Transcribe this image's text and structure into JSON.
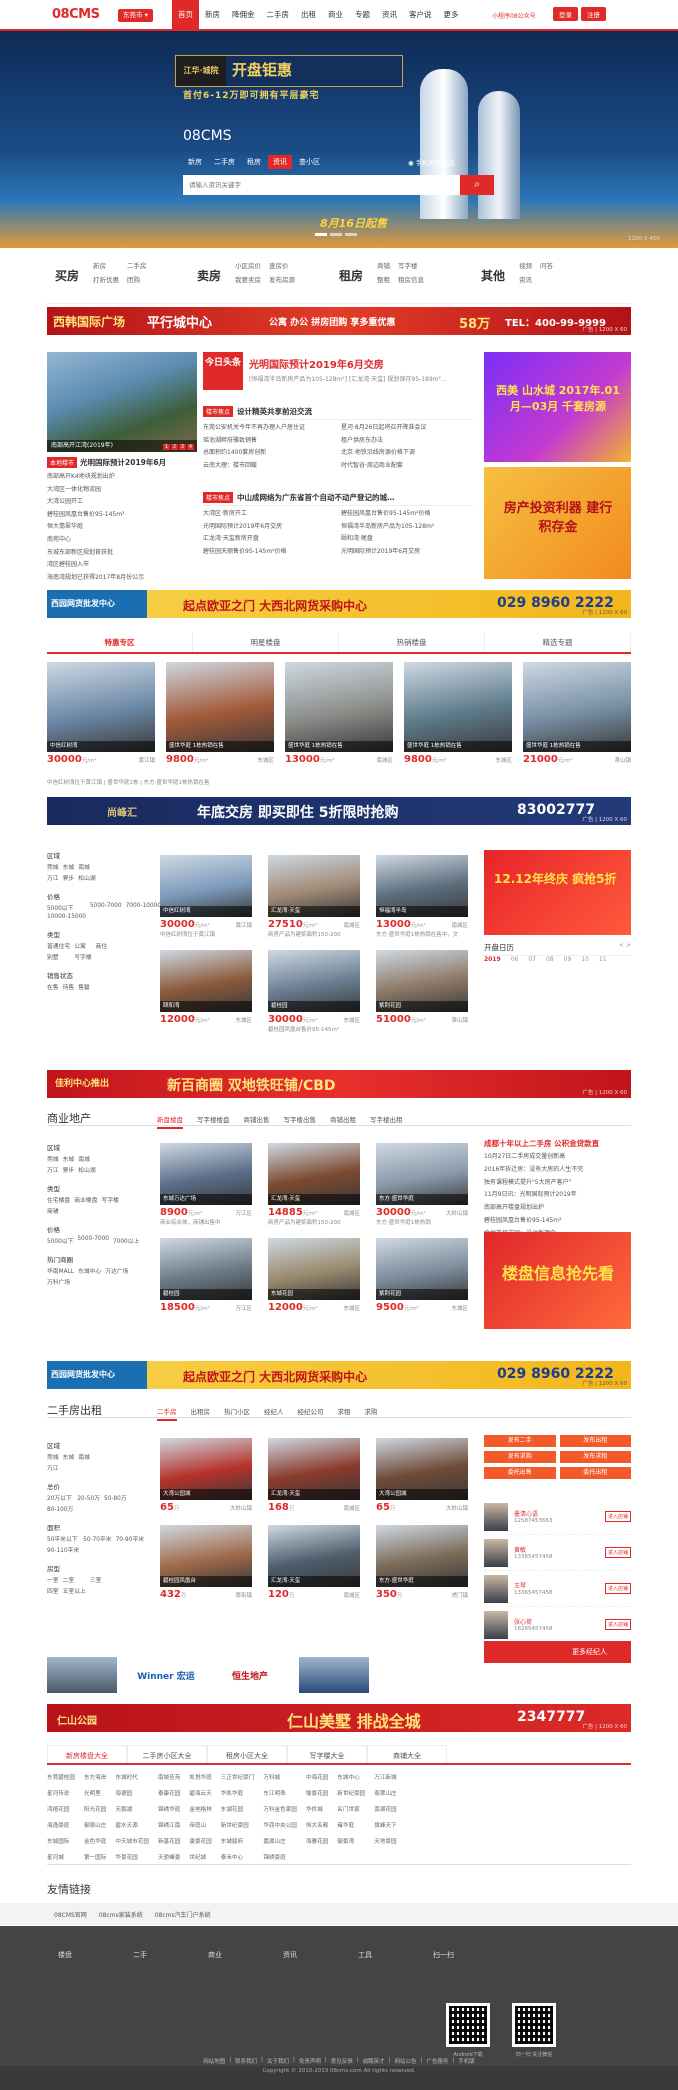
{
  "header": {
    "logo": "08CMS",
    "city": "东莞市",
    "nav": [
      "首页",
      "新房",
      "降佣金",
      "二手房",
      "出租",
      "商业",
      "专题",
      "资讯",
      "客户说",
      "更多"
    ],
    "hotline": "小程序08公众号",
    "login": "登录",
    "register": "注册"
  },
  "hero": {
    "promo_badge": "江华·城院",
    "promo_title": "开盘钜惠",
    "promo_sub": "首付6-12万即可拥有平层豪宅",
    "brand": "08CMS",
    "search_tabs": [
      "新房",
      "二手房",
      "租房",
      "资讯",
      "查小区"
    ],
    "search_active": 3,
    "map_link": "手机地图找房",
    "search_placeholder": "请输入资讯关键字",
    "search_icon": "search-icon",
    "slogan": "8月16日起售",
    "ad_size": "1200 X 450"
  },
  "quick_links": [
    {
      "title": "买房",
      "links": [
        "新房",
        "二手房",
        "打折优惠",
        "团购"
      ]
    },
    {
      "title": "卖房",
      "links": [
        "小区房价",
        "查房价",
        "我要卖房",
        "发布房源"
      ]
    },
    {
      "title": "租房",
      "links": [
        "商铺",
        "写字楼",
        "整租",
        "租房信息"
      ]
    },
    {
      "title": "其他",
      "links": [
        "视频",
        "问答",
        "资讯"
      ]
    }
  ],
  "banner1": {
    "left": "西韩国际广场",
    "mid": "平行城中心",
    "items": "公寓 办公 拼房团购 享多重优惠",
    "amount": "58万",
    "phone": "TEL：400-99-9999",
    "tag": "广告 | 1200 X 60"
  },
  "news": {
    "main_pic_caption": "南部高开江湾(2019年)",
    "main_pic_pages": [
      "1",
      "2",
      "3",
      "4"
    ],
    "left_head_tag": "本地楼市",
    "left_head_title": "光明国际预计2019年6月",
    "left_items": [
      "南部高开K4地块规划出炉",
      "大湾区一体化物流园",
      "大湾公园开工",
      "碧桂园凤凰台售价95-145m²",
      "恒大翡翠华庭",
      "南苑中心",
      "东城东部新区规划首获批",
      "湾区碧桂园入市",
      "海南湾规划已获得2017年8月份公示"
    ],
    "headline_logo": "今日头条",
    "headline_title": "光明国际预计2019年6月交房",
    "headline_sub": "[恒福湾半岛新房产品为105-128m²] [汇龙湾·天玺] 规划保存95-189m²…",
    "sections": [
      {
        "tag": "楼市焦点",
        "title": "设计精英共享前沿交流",
        "items": [
          "东莞公安机关今年不再办理入户居住证",
          "星河·8月26日起将召开降准会议",
          "瑶池湖畔府雅致销售",
          "租户供房东办法",
          "总面积约1400套房创新",
          "北京·地铁沿线房源价格下调",
          "云南大理：楼市回暖",
          "时代智谷·周边商业配套"
        ]
      },
      {
        "tag": "楼市焦点",
        "title": "中山成网络为广东省首个自动不动产登记的城…",
        "items": [
          "大湾区·新房开工",
          "碧桂园凤凰台售价95-145m²价格",
          "光明国际预计2019年6月交房",
          "恒福湾半岛新房产品为105-128m²",
          "汇龙湾·天玺新房开盘",
          "颐和湾·尾盘",
          "碧桂园天丽售价95-145m²价格",
          "光明国际预计2019年6月交房"
        ]
      }
    ],
    "right_ad1": "西美 山水城 2017年.01月—03月 千套房源",
    "right_ad2": "房产投资利器 建行积存金"
  },
  "banner2": {
    "left": "西园网货批发中心",
    "mid": "起点欧亚之门 大西北网货采购中心",
    "phone": "029 8960 2222",
    "tag": "广告 | 1200 X 60"
  },
  "special_tabs": [
    "特惠专区",
    "明星楼盘",
    "热销楼盘",
    "精选专题"
  ],
  "special_props": [
    {
      "cap": "中信红树湾",
      "price": "30000",
      "unit": "元/m²",
      "dist": "黄江镇",
      "c": "#6d89a8"
    },
    {
      "cap": "盛世华庭 1栋热销在售",
      "price": "9800",
      "unit": "元/m²",
      "dist": "东城区",
      "c": "#a35a3a"
    },
    {
      "cap": "盛世华庭 1栋热销在售",
      "price": "13000",
      "unit": "元/m²",
      "dist": "南城区",
      "c": "#8c8e8a"
    },
    {
      "cap": "盛世华庭 1栋热销在售",
      "price": "9800",
      "unit": "元/m²",
      "dist": "东城区",
      "c": "#5f7c8c"
    },
    {
      "cap": "盛世华庭 1栋热销在售",
      "price": "21000",
      "unit": "元/m²",
      "dist": "茶山镇",
      "c": "#7890a6"
    }
  ],
  "special_desc": "中信红树湾位于黄江镇 | 盛世华庭1栋 | 东方·盛世华庭1栋热销在售",
  "banner3": {
    "left": "尚峰汇",
    "mid": "年底交房 即买即住 5折限时抢购",
    "phone": "83002777",
    "tag": "广告 | 1200 X 60"
  },
  "newhouse": {
    "filters": [
      {
        "label": "区域",
        "opts": [
          "莞城",
          "东城",
          "南城",
          "万江",
          "寮步",
          "松山湖"
        ]
      },
      {
        "label": "价格",
        "opts": [
          "5000以下",
          "5000-7000",
          "7000-10000",
          "10000-15000"
        ]
      },
      {
        "label": "类型",
        "opts": [
          "普通住宅",
          "公寓",
          "商住",
          "别墅",
          "写字楼"
        ]
      },
      {
        "label": "销售状态",
        "opts": [
          "在售",
          "待售",
          "售罄"
        ]
      }
    ],
    "props": [
      {
        "cap": "中信红树湾",
        "price": "30000",
        "unit": "元/m²",
        "dist": "黄江镇",
        "desc": "中信红树湾位于黄江镇",
        "c": "#7c9abb"
      },
      {
        "cap": "汇龙湾·天玺",
        "price": "27510",
        "unit": "元/m²",
        "dist": "南城区",
        "desc": "新房产品为建筑面积150-200",
        "c": "#a08a76"
      },
      {
        "cap": "恒福湾半岛",
        "price": "13000",
        "unit": "元/m²",
        "dist": "南城区",
        "desc": "东方·盛世华庭1栋热销在售中，文",
        "c": "#5b6d7c"
      },
      {
        "cap": "颐和湾",
        "price": "12000",
        "unit": "元/m²",
        "dist": "东城区",
        "desc": "",
        "c": "#8a5a3c"
      },
      {
        "cap": "碧桂园",
        "price": "30000",
        "unit": "元/m²",
        "dist": "东城区",
        "desc": "碧桂园凤凰台售价95-145m²",
        "c": "#6b7f93"
      },
      {
        "cap": "紫荆花园",
        "price": "51000",
        "unit": "元/m²",
        "dist": "茶山镇",
        "desc": "",
        "c": "#8d7967"
      }
    ],
    "cal_ad": "12.12年终庆 疯抢5折",
    "cal_title": "开盘日历",
    "cal_nav": "< >",
    "cal_year": "2019",
    "cal_days": [
      "2019",
      "06",
      "07",
      "08",
      "09",
      "10",
      "11"
    ]
  },
  "banner4": {
    "left": "佳利中心推出",
    "mid": "新百商圈 双地铁旺铺/CBD",
    "tag": "广告 | 1200 X 60"
  },
  "commercial": {
    "title": "商业地产",
    "tabs": [
      "新盘楼盘",
      "写字楼楼盘",
      "商铺出售",
      "写字楼出售",
      "商铺出租",
      "写字楼出租"
    ],
    "filters": [
      {
        "label": "区域",
        "opts": [
          "莞城",
          "东城",
          "南城",
          "万江",
          "寮步",
          "松山湖"
        ]
      },
      {
        "label": "类型",
        "opts": [
          "住宅楼盘",
          "商业楼盘",
          "写字楼",
          "商铺"
        ]
      },
      {
        "label": "价格",
        "opts": [
          "5000以下",
          "5000-7000",
          "7000以上"
        ]
      },
      {
        "label": "热门商圈",
        "opts": [
          "华南MALL",
          "东城中心",
          "万达广场",
          "万科广场"
        ]
      }
    ],
    "props": [
      {
        "cap": "东城万达广场",
        "price": "8900",
        "unit": "元/m²",
        "dist": "万江区",
        "desc": "商业综合体，商铺出售中",
        "c": "#5a6e88"
      },
      {
        "cap": "汇龙湾·天玺",
        "price": "14885",
        "unit": "元/m²",
        "dist": "南城区",
        "desc": "新房产品为建筑面积150-200",
        "c": "#7c4a30"
      },
      {
        "cap": "东方·盛世华庭",
        "price": "30000",
        "unit": "元/m²",
        "dist": "大岭山镇",
        "desc": "东方·盛世华庭1栋热销",
        "c": "#8a9aaa"
      },
      {
        "cap": "碧桂园",
        "price": "18500",
        "unit": "元/m²",
        "dist": "万江区",
        "desc": "",
        "c": "#6d7b88"
      },
      {
        "cap": "东城花园",
        "price": "12000",
        "unit": "元/m²",
        "dist": "东城区",
        "desc": "",
        "c": "#9a8a6e"
      },
      {
        "cap": "紫荆花园",
        "price": "9500",
        "unit": "元/m²",
        "dist": "东城区",
        "desc": "",
        "c": "#7d8d9c"
      }
    ],
    "news_title": "成都十年以上二手房 公积金贷款直",
    "news": [
      "10月27日二手房成交量创新高",
      "2016年拆迁房：没有大房的人生不完",
      "独有课程模式提升\"5大房产客户\"",
      "11月9日讯：光明国际预计2019年",
      "南部高开楼盘规划出炉",
      "碧桂园凤凰台售价95-145m²",
      "金地艺境花园：设计新理念"
    ],
    "ad": "楼盘信息抢先看"
  },
  "banner5": {
    "left": "西园网货批发中心",
    "mid": "起点欧亚之门 大西北网货采购中心",
    "phone": "029 8960 2222",
    "tag": "广告 | 1200 X 60"
  },
  "secondhand": {
    "title": "二手房出租",
    "tabs": [
      "二手房",
      "出租房",
      "热门小区",
      "经纪人",
      "经纪公司",
      "求租",
      "求购"
    ],
    "filters": [
      {
        "label": "区域",
        "opts": [
          "莞城",
          "东城",
          "南城",
          "万江"
        ]
      },
      {
        "label": "总价",
        "opts": [
          "20万以下",
          "20-50万",
          "50-80万",
          "80-100万"
        ]
      },
      {
        "label": "面积",
        "opts": [
          "50平米以下",
          "50-70平米",
          "70-90平米",
          "90-110平米"
        ]
      },
      {
        "label": "房型",
        "opts": [
          "一室",
          "二室",
          "三室",
          "四室",
          "五室以上"
        ]
      }
    ],
    "props": [
      {
        "cap": "大湾公园城",
        "price": "65",
        "unit": "万",
        "dist": "大岭山镇",
        "c": "#b5322a"
      },
      {
        "cap": "汇龙湾·天玺",
        "price": "168",
        "unit": "万",
        "dist": "南城区",
        "c": "#8a3a2c"
      },
      {
        "cap": "大湾公园城",
        "price": "65",
        "unit": "万",
        "dist": "大岭山镇",
        "c": "#6e4a38"
      },
      {
        "cap": "碧桂园凤凰台",
        "price": "432",
        "unit": "万",
        "dist": "厚街镇",
        "c": "#a06a4a"
      },
      {
        "cap": "汇龙湾·天玺",
        "price": "120",
        "unit": "万",
        "dist": "南城区",
        "c": "#4e5e6c"
      },
      {
        "cap": "东方·盛世华庭",
        "price": "350",
        "unit": "万",
        "dist": "虎门镇",
        "c": "#7a6a58"
      }
    ],
    "buttons": [
      "发布二手",
      "发布出租",
      "发布求购",
      "发布求租",
      "委托出售",
      "委托出租"
    ],
    "agents": [
      {
        "name": "墨清心语",
        "phone": "12587453663",
        "btn": "进入店铺"
      },
      {
        "name": "黄敏",
        "phone": "13365457458",
        "btn": "进入店铺"
      },
      {
        "name": "王琴",
        "phone": "13365457458",
        "btn": "进入店铺"
      },
      {
        "name": "张心荷",
        "phone": "18265457458",
        "btn": "进入店铺"
      }
    ],
    "more_agents": "更多经纪人"
  },
  "logos": [
    {
      "text": "",
      "c": "#4a5868"
    },
    {
      "text": "Winner 宏运",
      "c": "#1a5fb4"
    },
    {
      "text": "恒生地产",
      "c": "#c0141b"
    },
    {
      "text": "",
      "c": "#2a4b7a"
    },
    {
      "text": "",
      "c": "#38b040"
    }
  ],
  "banner6": {
    "left": "仁山公园",
    "mid": "仁山美墅 排战全城",
    "phone": "2347777",
    "tag": "广告 | 1200 X 60"
  },
  "directory": {
    "tabs": [
      "新房楼盘大全",
      "二手房小区大全",
      "租房小区大全",
      "写字楼大全",
      "商铺大全"
    ],
    "items": [
      "东莞碧桂园",
      "东方海岸",
      "东城时代",
      "南城佳苑",
      "凯悦华庭",
      "三正世纪豪门",
      "万科城",
      "中海花园",
      "东城中心",
      "万江新城",
      "星河传说",
      "光明里",
      "海德园",
      "泰康花园",
      "碧海云天",
      "华凯华庭",
      "东江明珠",
      "愉景花园",
      "新世纪豪园",
      "翡翠山庄",
      "鸿禧花园",
      "阳光花园",
      "天鹅湖",
      "锦绣华庭",
      "金地格林",
      "东湖花园",
      "万科金色家园",
      "华侨城",
      "名门世家",
      "南湖花园",
      "海逸豪庭",
      "御泉山庄",
      "碧水天源",
      "锦绣江南",
      "帝庭山",
      "新世纪豪园",
      "华润中央公园",
      "恒大名都",
      "雍华庭",
      "旗峰天下",
      "东城国际",
      "金色华庭",
      "中天城市花园",
      "新基花园",
      "骏景花园",
      "东城骏府",
      "嘉湖山庄",
      "海雅花园",
      "御景湾",
      "天地豪园",
      "星河城",
      "第一国际",
      "华景花园",
      "天骄峰景",
      "世纪城",
      "泰禾中心",
      "锦绣豪庭"
    ]
  },
  "friends": {
    "title": "友情链接",
    "links": [
      "08CMS官网",
      "08cms家装系统",
      "08cms汽车门户系统"
    ]
  },
  "footer": {
    "cols": [
      "楼盘",
      "二手",
      "商业",
      "资讯",
      "工具",
      "扫一扫"
    ],
    "qr_caps": [
      "Android下载",
      "扫一扫 关注微信"
    ],
    "links": [
      "网站地图",
      "联系我们",
      "关于我们",
      "免责声明",
      "意见反馈",
      "诚聘英才",
      "网站公告",
      "广告服务",
      "手机版"
    ],
    "copyright": "Copyright © 2010-2019 08cms.com All rights reserved."
  }
}
